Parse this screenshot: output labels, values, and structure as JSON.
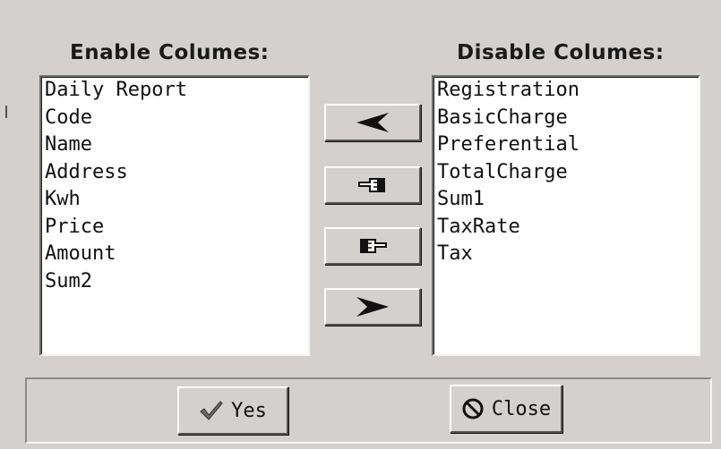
{
  "enable_panel": {
    "title": "Enable Columes:",
    "items": [
      "Daily Report",
      "Code",
      "Name",
      "Address",
      "Kwh",
      "Price",
      "Amount",
      "Sum2"
    ]
  },
  "disable_panel": {
    "title": "Disable Columes:",
    "items": [
      "Registration",
      "BasicCharge",
      "Preferential",
      "TotalCharge",
      "Sum1",
      "TaxRate",
      "Tax"
    ]
  },
  "transfer_buttons": {
    "move_left_icon": "arrow-left-icon",
    "move_all_left_icon": "hand-pointing-left-icon",
    "move_all_right_icon": "hand-pointing-right-icon",
    "move_right_icon": "arrow-right-icon"
  },
  "footer": {
    "yes_label": "Yes",
    "close_label": "Close",
    "yes_icon": "checkmark-icon",
    "close_icon": "no-sign-icon"
  },
  "colors": {
    "dialog_background": "#d3d0cd",
    "list_background": "#ffffff",
    "text": "#111111",
    "checkmark": "#6a6a6a"
  }
}
